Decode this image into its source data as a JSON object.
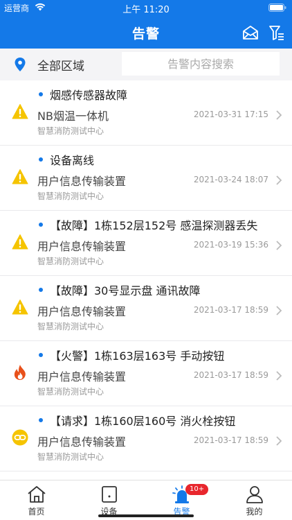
{
  "status_bar": {
    "carrier": "运营商",
    "time": "上午 11:20"
  },
  "header": {
    "title": "告警"
  },
  "filter": {
    "region_label": "全部区域",
    "search_placeholder": "告警内容搜索"
  },
  "alarms": [
    {
      "title": "烟感传感器故障",
      "device": "NB烟温一体机",
      "time": "2021-03-31 17:15",
      "org": "智慧消防测试中心",
      "icon": "warning-icon"
    },
    {
      "title": "设备离线",
      "device": "用户信息传输装置",
      "time": "2021-03-24 18:07",
      "org": "智慧消防测试中心",
      "icon": "warning-icon"
    },
    {
      "title": "【故障】1栋152层152号 感温探测器丢失",
      "device": "用户信息传输装置",
      "time": "2021-03-19 15:36",
      "org": "智慧消防测试中心",
      "icon": "warning-icon"
    },
    {
      "title": "【故障】30号显示盘 通讯故障",
      "device": "用户信息传输装置",
      "time": "2021-03-17 18:59",
      "org": "智慧消防测试中心",
      "icon": "warning-icon"
    },
    {
      "title": "【火警】1栋163层163号 手动按钮",
      "device": "用户信息传输装置",
      "time": "2021-03-17 18:59",
      "org": "智慧消防测试中心",
      "icon": "fire-icon"
    },
    {
      "title": "【请求】1栋160层160号 消火栓按钮",
      "device": "用户信息传输装置",
      "time": "2021-03-17 18:59",
      "org": "智慧消防测试中心",
      "icon": "link-icon"
    }
  ],
  "tabs": [
    {
      "label": "首页",
      "icon": "home-icon"
    },
    {
      "label": "设备",
      "icon": "device-icon"
    },
    {
      "label": "告警",
      "icon": "alarm-light-icon",
      "badge": "10+"
    },
    {
      "label": "我的",
      "icon": "user-icon"
    }
  ],
  "colors": {
    "primary": "#1479e8",
    "warning": "#f5c400",
    "fire": "#e8501a",
    "badge": "#e8262d"
  }
}
